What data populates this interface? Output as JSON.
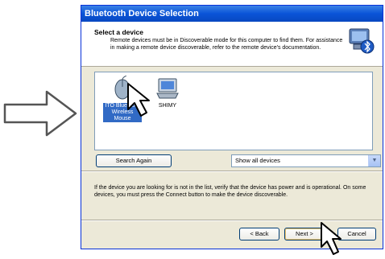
{
  "window": {
    "title": "Bluetooth Device Selection"
  },
  "header": {
    "heading": "Select a device",
    "description": "Remote devices must be in Discoverable mode for this computer to find them. For assistance in making a remote device discoverable, refer to the remote device's documentation.",
    "icon": "bluetooth-computer-icon"
  },
  "devices": [
    {
      "label": "ITO Bluetooth Wireless Mouse",
      "icon": "mouse-icon",
      "selected": true
    },
    {
      "label": "SHIMY",
      "icon": "computer-icon",
      "selected": false
    }
  ],
  "search_again_label": "Search Again",
  "filter": {
    "selected": "Show all devices"
  },
  "info_text": "If the device you are looking for is not in the list, verify that the device has power and is operational. On some devices, you must press the Connect button to make the device discoverable.",
  "buttons": {
    "back": "< Back",
    "next": "Next >",
    "cancel": "Cancel"
  },
  "colors": {
    "titlebar": "#0a54d8",
    "selection": "#316ac5",
    "dialog_bg": "#ece9d8"
  }
}
